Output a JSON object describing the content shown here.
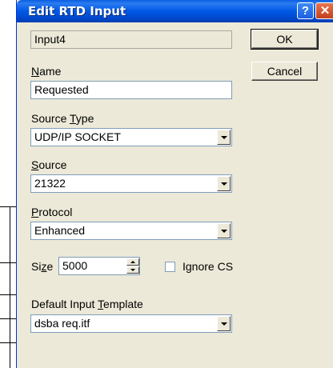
{
  "dialog": {
    "title": "Edit RTD Input",
    "help_glyph": "?",
    "close_glyph": "✕"
  },
  "input_id": "Input4",
  "buttons": {
    "ok": "OK",
    "cancel": "Cancel"
  },
  "name": {
    "label_u": "N",
    "label_rest": "ame",
    "value": "Requested"
  },
  "source_type": {
    "label_pre": "Source ",
    "label_u": "T",
    "label_rest": "ype",
    "value": "UDP/IP SOCKET"
  },
  "source": {
    "label_u": "S",
    "label_rest": "ource",
    "value": "21322"
  },
  "protocol": {
    "label_u": "P",
    "label_rest": "rotocol",
    "value": "Enhanced"
  },
  "size": {
    "label_pre": "Si",
    "label_u": "z",
    "label_rest": "e",
    "value": "5000"
  },
  "ignore_cs": {
    "label": "Ignore CS",
    "checked": false
  },
  "template": {
    "label_pre": "Default Input ",
    "label_u": "T",
    "label_rest": "emplate",
    "value": "dsba req.itf"
  },
  "colors": {
    "dialog_bg": "#ece9d8",
    "titlebar": "#0058e6",
    "field_border": "#7f9db9"
  }
}
